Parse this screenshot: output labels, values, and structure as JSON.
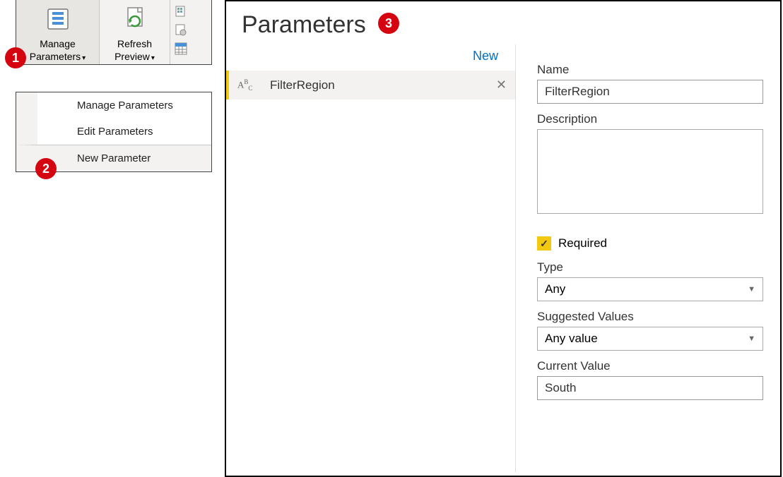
{
  "ribbon": {
    "manage_parameters_label": "Manage\nParameters",
    "refresh_preview_label": "Refresh\nPreview"
  },
  "menu": {
    "manage_parameters": "Manage Parameters",
    "edit_parameters": "Edit Parameters",
    "new_parameter": "New Parameter"
  },
  "dialog": {
    "title": "Parameters",
    "new_link": "New",
    "entries": [
      {
        "type_icon_text": "ABC",
        "name": "FilterRegion"
      }
    ]
  },
  "form": {
    "name_label": "Name",
    "name_value": "FilterRegion",
    "description_label": "Description",
    "description_value": "",
    "required_label": "Required",
    "required_checked": true,
    "type_label": "Type",
    "type_value": "Any",
    "suggested_label": "Suggested Values",
    "suggested_value": "Any value",
    "current_label": "Current Value",
    "current_value": "South"
  },
  "badges": {
    "b1": "1",
    "b2": "2",
    "b3": "3"
  }
}
